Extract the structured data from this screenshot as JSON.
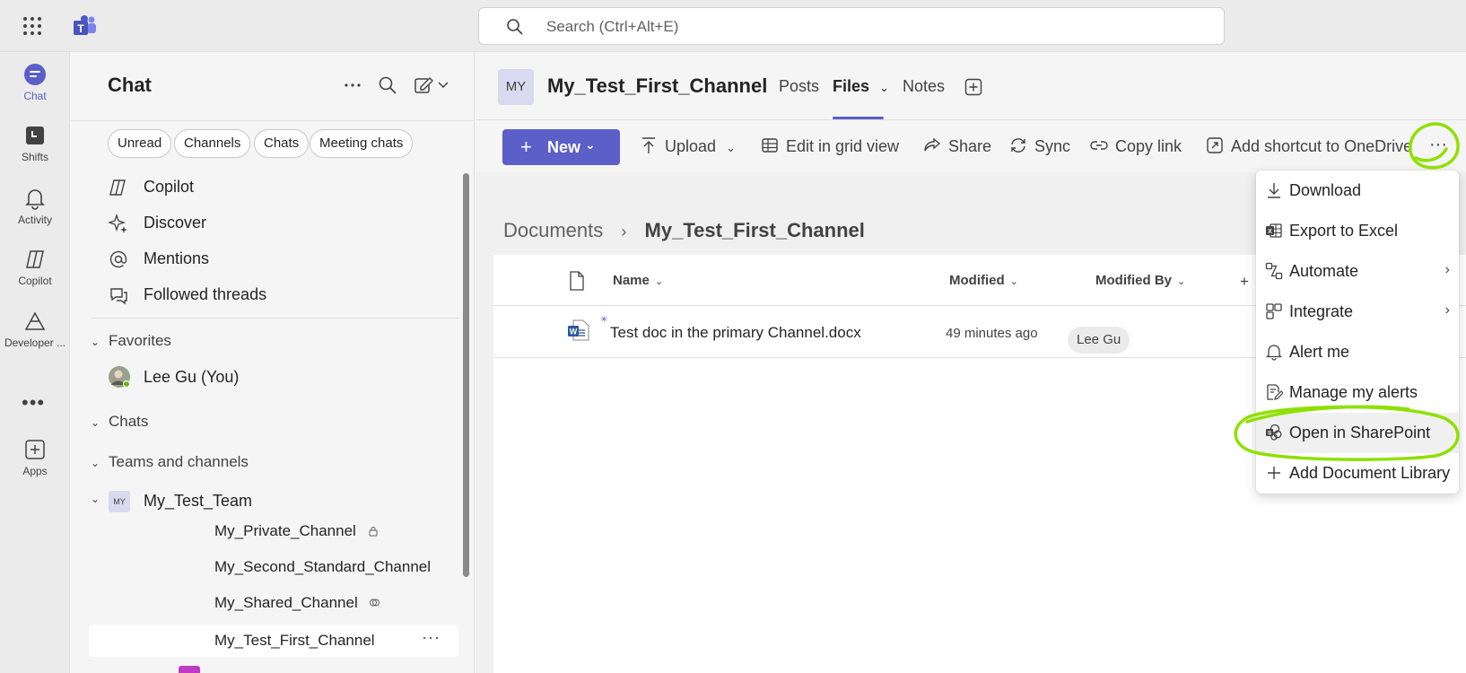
{
  "topbar": {
    "search_placeholder": "Search (Ctrl+Alt+E)"
  },
  "rail": {
    "items": [
      {
        "label": "Chat",
        "icon": "chat-icon",
        "active": true
      },
      {
        "label": "Shifts",
        "icon": "shifts-icon"
      },
      {
        "label": "Activity",
        "icon": "bell-icon"
      },
      {
        "label": "Copilot",
        "icon": "copilot-icon"
      },
      {
        "label": "Developer ...",
        "icon": "developer-portal-icon"
      },
      {
        "label": "Apps",
        "icon": "apps-add-icon"
      }
    ],
    "more": "•••"
  },
  "chatpane": {
    "title": "Chat",
    "filters": [
      "Unread",
      "Channels",
      "Chats",
      "Meeting chats"
    ],
    "quick_items": [
      {
        "label": "Copilot",
        "icon": "copilot-icon"
      },
      {
        "label": "Discover",
        "icon": "sparkle-icon"
      },
      {
        "label": "Mentions",
        "icon": "at-icon"
      },
      {
        "label": "Followed threads",
        "icon": "threads-icon"
      }
    ],
    "favorites_label": "Favorites",
    "favorite_user": "Lee Gu (You)",
    "chats_label": "Chats",
    "teams_label": "Teams and channels",
    "team_avatar": "MY",
    "team_name": "My_Test_Team",
    "channels": [
      "My_Private_Channel",
      "My_Second_Standard_Channel",
      "My_Shared_Channel",
      "My_Test_First_Channel"
    ],
    "row_more": "···"
  },
  "channel": {
    "avatar": "MY",
    "name": "My_Test_First_Channel",
    "tabs": [
      "Posts",
      "Files",
      "Notes"
    ],
    "active_tab": "Files"
  },
  "toolbar": {
    "new_label": "New",
    "upload": "Upload",
    "edit_grid": "Edit in grid view",
    "share": "Share",
    "sync": "Sync",
    "copy_link": "Copy link",
    "add_shortcut": "Add shortcut to OneDrive",
    "more": "···"
  },
  "files": {
    "breadcrumb_root": "Documents",
    "breadcrumb_current": "My_Test_First_Channel",
    "columns": {
      "name": "Name",
      "modified": "Modified",
      "modified_by": "Modified By"
    },
    "rows": [
      {
        "name": "Test doc in the primary Channel.docx",
        "modified": "49 minutes ago",
        "modified_by": "Lee Gu"
      }
    ]
  },
  "menu": {
    "items": [
      {
        "label": "Download",
        "icon": "download-icon"
      },
      {
        "label": "Export to Excel",
        "icon": "excel-icon"
      },
      {
        "label": "Automate",
        "icon": "automate-icon",
        "submenu": true
      },
      {
        "label": "Integrate",
        "icon": "integrate-icon",
        "submenu": true
      },
      {
        "label": "Alert me",
        "icon": "bell-icon"
      },
      {
        "label": "Manage my alerts",
        "icon": "manage-alerts-icon"
      },
      {
        "label": "Open in SharePoint",
        "icon": "sharepoint-icon",
        "highlighted": true
      },
      {
        "label": "Add Document Library",
        "icon": "plus-icon"
      }
    ]
  },
  "colors": {
    "accent": "#5b5fc7",
    "annotation": "#8fe000"
  }
}
